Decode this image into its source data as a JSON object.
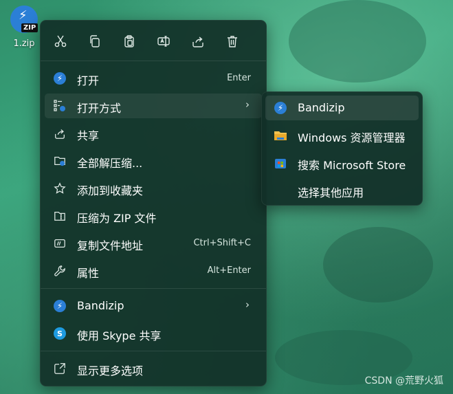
{
  "desktop": {
    "file_name": "1.zip",
    "zip_tag": "ZIP"
  },
  "toolbar": {
    "icons": [
      "cut-icon",
      "copy-icon",
      "paste-icon",
      "rename-icon",
      "share-icon",
      "delete-icon"
    ]
  },
  "menu": {
    "open": {
      "label": "打开",
      "shortcut": "Enter"
    },
    "open_with": {
      "label": "打开方式"
    },
    "share": {
      "label": "共享"
    },
    "extract_all": {
      "label": "全部解压缩..."
    },
    "add_favorites": {
      "label": "添加到收藏夹"
    },
    "compress_zip": {
      "label": "压缩为 ZIP 文件"
    },
    "copy_path": {
      "label": "复制文件地址",
      "shortcut": "Ctrl+Shift+C"
    },
    "properties": {
      "label": "属性",
      "shortcut": "Alt+Enter"
    },
    "bandizip": {
      "label": "Bandizip"
    },
    "skype_share": {
      "label": "使用 Skype 共享"
    },
    "more_options": {
      "label": "显示更多选项"
    }
  },
  "submenu": {
    "items": [
      {
        "label": "Bandizip"
      },
      {
        "label": "Windows 资源管理器"
      },
      {
        "label": "搜索 Microsoft Store"
      },
      {
        "label": "选择其他应用"
      }
    ]
  },
  "watermark": "CSDN @荒野火狐",
  "colors": {
    "accent": "#2b7fd6",
    "menu_bg": "#12302a"
  }
}
